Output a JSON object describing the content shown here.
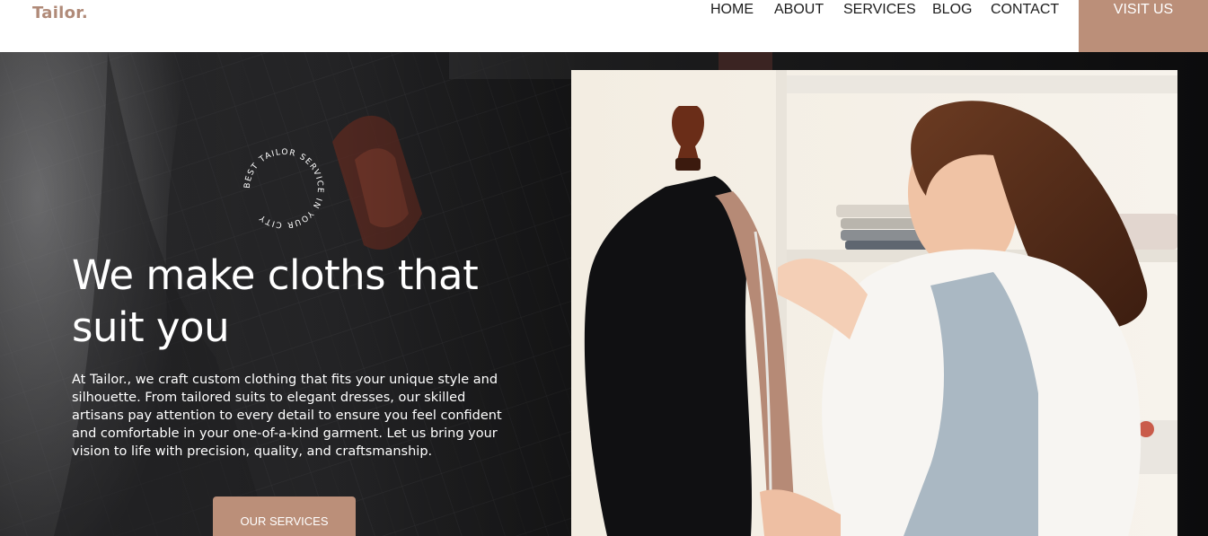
{
  "header": {
    "logo": "Tailor.",
    "nav": [
      {
        "label": "HOME"
      },
      {
        "label": "ABOUT"
      },
      {
        "label": "SERVICES"
      },
      {
        "label": "BLOG"
      },
      {
        "label": "CONTACT"
      }
    ],
    "cta_label": "VISIT US"
  },
  "hero": {
    "badge_text": "BEST TAILOR SERVICE IN YOUR CITY",
    "title": "We make cloths that suit you",
    "description": "At Tailor., we craft custom clothing that fits your unique style and silhouette. From tailored suits to elegant dresses, our skilled artisans pay attention to every detail to ensure you feel confident and comfortable in your one-of-a-kind garment. Let us bring your vision to life with precision, quality, and craftsmanship.",
    "button_label": "OUR SERVICES"
  },
  "colors": {
    "accent": "#bb8f79",
    "logo": "#b08a78",
    "hero_bg": "#242426",
    "text_light": "#ffffff"
  }
}
